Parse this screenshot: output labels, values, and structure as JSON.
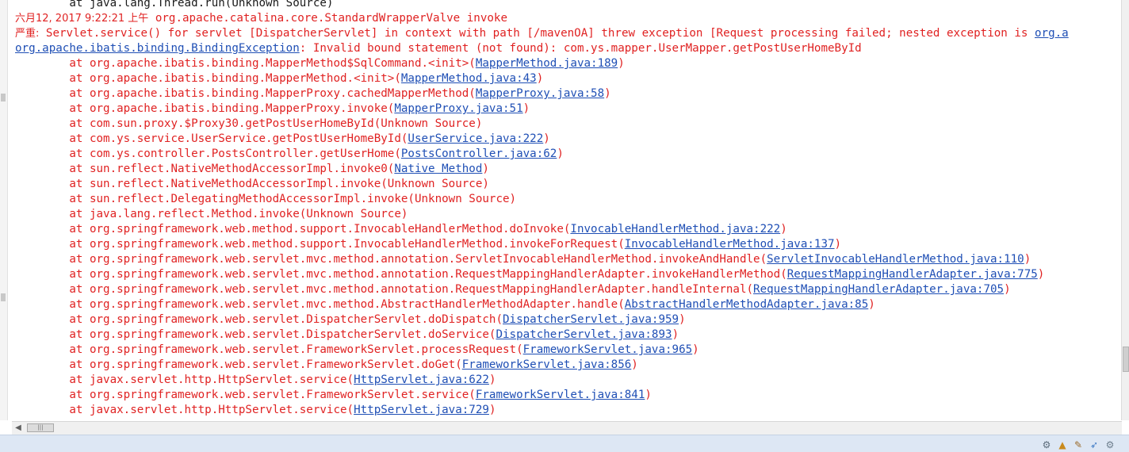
{
  "console": {
    "prev_line": "        at java.lang.Thread.run(Unknown Source)",
    "timestamp": "六月12, 2017 9:22:21 上午",
    "timestamp_rest": " org.apache.catalina.core.StandardWrapperValve invoke",
    "severity": "严重:",
    "error_text": " Servlet.service() for servlet [DispatcherServlet] in context with path [/mavenOA] threw exception [Request processing failed; nested exception is ",
    "error_link_tail": "org.a",
    "exception_link": "org.apache.ibatis.binding.BindingException",
    "exception_msg": ": Invalid bound statement (not found): com.ys.mapper.UserMapper.getPostUserHomeById",
    "frames": [
      {
        "pre": "        at org.apache.ibatis.binding.MapperMethod$SqlCommand.<init>(",
        "link": "MapperMethod.java:189",
        "post": ")"
      },
      {
        "pre": "        at org.apache.ibatis.binding.MapperMethod.<init>(",
        "link": "MapperMethod.java:43",
        "post": ")"
      },
      {
        "pre": "        at org.apache.ibatis.binding.MapperProxy.cachedMapperMethod(",
        "link": "MapperProxy.java:58",
        "post": ")"
      },
      {
        "pre": "        at org.apache.ibatis.binding.MapperProxy.invoke(",
        "link": "MapperProxy.java:51",
        "post": ")"
      },
      {
        "pre": "        at com.sun.proxy.$Proxy30.getPostUserHomeById(Unknown Source)",
        "link": "",
        "post": ""
      },
      {
        "pre": "        at com.ys.service.UserService.getPostUserHomeById(",
        "link": "UserService.java:222",
        "post": ")"
      },
      {
        "pre": "        at com.ys.controller.PostsController.getUserHome(",
        "link": "PostsController.java:62",
        "post": ")"
      },
      {
        "pre": "        at sun.reflect.NativeMethodAccessorImpl.invoke0(",
        "link": "Native Method",
        "post": ")"
      },
      {
        "pre": "        at sun.reflect.NativeMethodAccessorImpl.invoke(Unknown Source)",
        "link": "",
        "post": ""
      },
      {
        "pre": "        at sun.reflect.DelegatingMethodAccessorImpl.invoke(Unknown Source)",
        "link": "",
        "post": ""
      },
      {
        "pre": "        at java.lang.reflect.Method.invoke(Unknown Source)",
        "link": "",
        "post": ""
      },
      {
        "pre": "        at org.springframework.web.method.support.InvocableHandlerMethod.doInvoke(",
        "link": "InvocableHandlerMethod.java:222",
        "post": ")"
      },
      {
        "pre": "        at org.springframework.web.method.support.InvocableHandlerMethod.invokeForRequest(",
        "link": "InvocableHandlerMethod.java:137",
        "post": ")"
      },
      {
        "pre": "        at org.springframework.web.servlet.mvc.method.annotation.ServletInvocableHandlerMethod.invokeAndHandle(",
        "link": "ServletInvocableHandlerMethod.java:110",
        "post": ")"
      },
      {
        "pre": "        at org.springframework.web.servlet.mvc.method.annotation.RequestMappingHandlerAdapter.invokeHandlerMethod(",
        "link": "RequestMappingHandlerAdapter.java:775",
        "post": ")"
      },
      {
        "pre": "        at org.springframework.web.servlet.mvc.method.annotation.RequestMappingHandlerAdapter.handleInternal(",
        "link": "RequestMappingHandlerAdapter.java:705",
        "post": ")"
      },
      {
        "pre": "        at org.springframework.web.servlet.mvc.method.AbstractHandlerMethodAdapter.handle(",
        "link": "AbstractHandlerMethodAdapter.java:85",
        "post": ")"
      },
      {
        "pre": "        at org.springframework.web.servlet.DispatcherServlet.doDispatch(",
        "link": "DispatcherServlet.java:959",
        "post": ")"
      },
      {
        "pre": "        at org.springframework.web.servlet.DispatcherServlet.doService(",
        "link": "DispatcherServlet.java:893",
        "post": ")"
      },
      {
        "pre": "        at org.springframework.web.servlet.FrameworkServlet.processRequest(",
        "link": "FrameworkServlet.java:965",
        "post": ")"
      },
      {
        "pre": "        at org.springframework.web.servlet.FrameworkServlet.doGet(",
        "link": "FrameworkServlet.java:856",
        "post": ")"
      },
      {
        "pre": "        at javax.servlet.http.HttpServlet.service(",
        "link": "HttpServlet.java:622",
        "post": ")"
      },
      {
        "pre": "        at org.springframework.web.servlet.FrameworkServlet.service(",
        "link": "FrameworkServlet.java:841",
        "post": ")"
      },
      {
        "pre": "        at javax.servlet.http.HttpServlet.service(",
        "link": "HttpServlet.java:729",
        "post": ")"
      }
    ]
  },
  "scrollbar": {
    "left_arrow": "◀",
    "thumb_grip": "|||"
  },
  "tray_icons": [
    "settings-icon",
    "hat-icon",
    "pencil-icon",
    "rocket-icon",
    "gear-icon"
  ],
  "colors": {
    "error_text": "#e02222",
    "link": "#1f4fb5",
    "status_bar": "#dde7f4"
  }
}
